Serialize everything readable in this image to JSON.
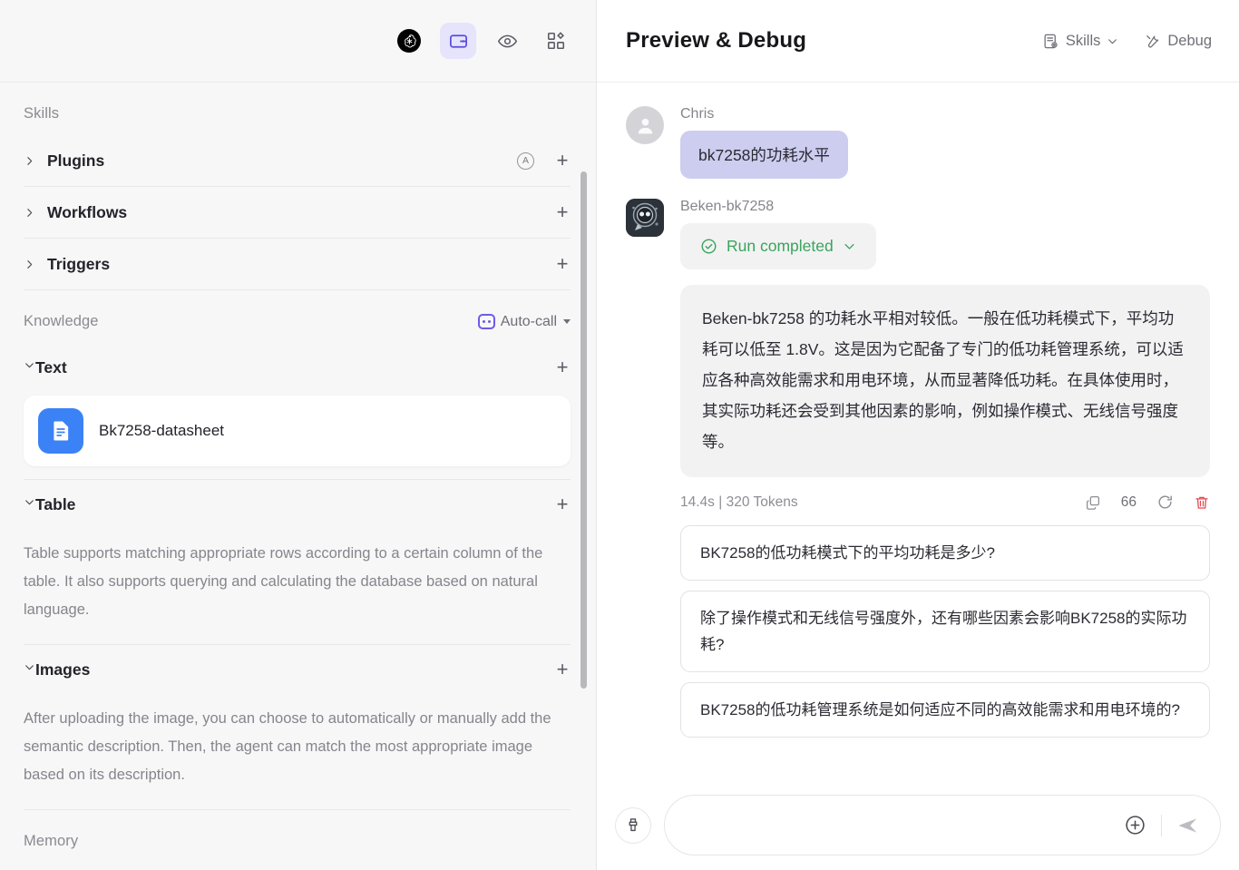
{
  "left_toolbar": {
    "buttons": [
      {
        "name": "openai-logo-icon",
        "label": "OpenAI"
      },
      {
        "name": "card-icon",
        "label": "Card",
        "active": true
      },
      {
        "name": "eye-icon",
        "label": "Preview"
      },
      {
        "name": "grid-apps-icon",
        "label": "Apps"
      }
    ]
  },
  "sidebar": {
    "skills": {
      "label": "Skills",
      "rows": [
        {
          "title": "Plugins",
          "expanded": false,
          "badge": "A",
          "add": "+"
        },
        {
          "title": "Workflows",
          "expanded": false,
          "add": "+"
        },
        {
          "title": "Triggers",
          "expanded": false,
          "add": "+"
        }
      ]
    },
    "knowledge": {
      "label": "Knowledge",
      "auto_call": "Auto-call",
      "groups": [
        {
          "title": "Text",
          "expanded": true,
          "add": "+",
          "items": [
            {
              "name": "Bk7258-datasheet"
            }
          ],
          "description": ""
        },
        {
          "title": "Table",
          "expanded": true,
          "add": "+",
          "items": [],
          "description": "Table supports matching appropriate rows according to a certain column of the table. It also supports querying and calculating the database based on natural language."
        },
        {
          "title": "Images",
          "expanded": true,
          "add": "+",
          "items": [],
          "description": "After uploading the image, you can choose to automatically or manually add the semantic description. Then, the agent can match the most appropriate image based on its description."
        }
      ]
    },
    "memory": {
      "label": "Memory"
    }
  },
  "preview": {
    "title": "Preview & Debug",
    "skills_button": "Skills",
    "debug_button": "Debug"
  },
  "conversation": {
    "user": {
      "name": "Chris",
      "message": "bk7258的功耗水平"
    },
    "assistant": {
      "name": "Beken-bk7258",
      "run_status": "Run completed",
      "message": "Beken-bk7258 的功耗水平相对较低。一般在低功耗模式下，平均功耗可以低至 1.8V。这是因为它配备了专门的低功耗管理系统，可以适应各种高效能需求和用电环境，从而显著降低功耗。在具体使用时，其实际功耗还会受到其他因素的影响，例如操作模式、无线信号强度等。",
      "duration": "14.4s",
      "separator": "|",
      "tokens": "320 Tokens",
      "count": "66"
    },
    "suggestions": [
      "BK7258的低功耗模式下的平均功耗是多少?",
      "除了操作模式和无线信号强度外，还有哪些因素会影响BK7258的实际功耗?",
      "BK7258的低功耗管理系统是如何适应不同的高效能需求和用电环境的?"
    ]
  },
  "composer": {
    "placeholder": "",
    "value": ""
  },
  "colors": {
    "accent_purple": "#6b5ce7",
    "user_bubble": "#cdcdf0",
    "success_green": "#3aa55d",
    "danger_red": "#e5484d",
    "doc_icon_blue": "#3b82f6"
  }
}
